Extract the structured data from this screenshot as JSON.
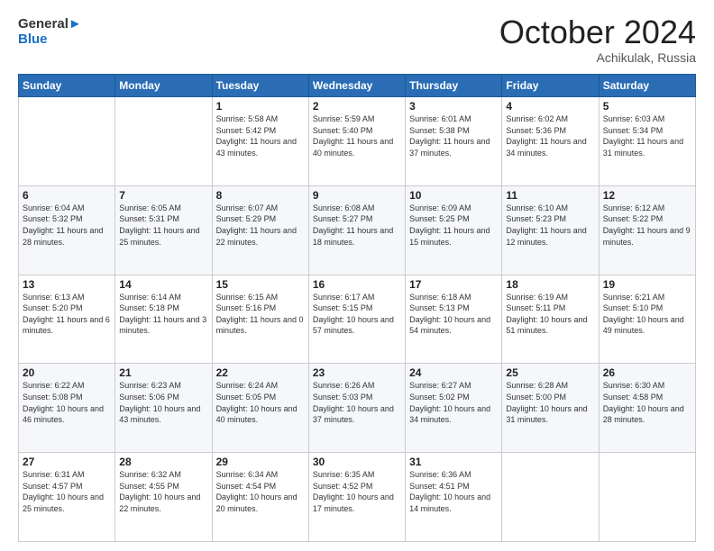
{
  "header": {
    "logo_general": "General",
    "logo_blue": "Blue",
    "month_title": "October 2024",
    "location": "Achikulak, Russia"
  },
  "weekdays": [
    "Sunday",
    "Monday",
    "Tuesday",
    "Wednesday",
    "Thursday",
    "Friday",
    "Saturday"
  ],
  "weeks": [
    [
      {
        "day": "",
        "info": ""
      },
      {
        "day": "",
        "info": ""
      },
      {
        "day": "1",
        "info": "Sunrise: 5:58 AM\nSunset: 5:42 PM\nDaylight: 11 hours and 43 minutes."
      },
      {
        "day": "2",
        "info": "Sunrise: 5:59 AM\nSunset: 5:40 PM\nDaylight: 11 hours and 40 minutes."
      },
      {
        "day": "3",
        "info": "Sunrise: 6:01 AM\nSunset: 5:38 PM\nDaylight: 11 hours and 37 minutes."
      },
      {
        "day": "4",
        "info": "Sunrise: 6:02 AM\nSunset: 5:36 PM\nDaylight: 11 hours and 34 minutes."
      },
      {
        "day": "5",
        "info": "Sunrise: 6:03 AM\nSunset: 5:34 PM\nDaylight: 11 hours and 31 minutes."
      }
    ],
    [
      {
        "day": "6",
        "info": "Sunrise: 6:04 AM\nSunset: 5:32 PM\nDaylight: 11 hours and 28 minutes."
      },
      {
        "day": "7",
        "info": "Sunrise: 6:05 AM\nSunset: 5:31 PM\nDaylight: 11 hours and 25 minutes."
      },
      {
        "day": "8",
        "info": "Sunrise: 6:07 AM\nSunset: 5:29 PM\nDaylight: 11 hours and 22 minutes."
      },
      {
        "day": "9",
        "info": "Sunrise: 6:08 AM\nSunset: 5:27 PM\nDaylight: 11 hours and 18 minutes."
      },
      {
        "day": "10",
        "info": "Sunrise: 6:09 AM\nSunset: 5:25 PM\nDaylight: 11 hours and 15 minutes."
      },
      {
        "day": "11",
        "info": "Sunrise: 6:10 AM\nSunset: 5:23 PM\nDaylight: 11 hours and 12 minutes."
      },
      {
        "day": "12",
        "info": "Sunrise: 6:12 AM\nSunset: 5:22 PM\nDaylight: 11 hours and 9 minutes."
      }
    ],
    [
      {
        "day": "13",
        "info": "Sunrise: 6:13 AM\nSunset: 5:20 PM\nDaylight: 11 hours and 6 minutes."
      },
      {
        "day": "14",
        "info": "Sunrise: 6:14 AM\nSunset: 5:18 PM\nDaylight: 11 hours and 3 minutes."
      },
      {
        "day": "15",
        "info": "Sunrise: 6:15 AM\nSunset: 5:16 PM\nDaylight: 11 hours and 0 minutes."
      },
      {
        "day": "16",
        "info": "Sunrise: 6:17 AM\nSunset: 5:15 PM\nDaylight: 10 hours and 57 minutes."
      },
      {
        "day": "17",
        "info": "Sunrise: 6:18 AM\nSunset: 5:13 PM\nDaylight: 10 hours and 54 minutes."
      },
      {
        "day": "18",
        "info": "Sunrise: 6:19 AM\nSunset: 5:11 PM\nDaylight: 10 hours and 51 minutes."
      },
      {
        "day": "19",
        "info": "Sunrise: 6:21 AM\nSunset: 5:10 PM\nDaylight: 10 hours and 49 minutes."
      }
    ],
    [
      {
        "day": "20",
        "info": "Sunrise: 6:22 AM\nSunset: 5:08 PM\nDaylight: 10 hours and 46 minutes."
      },
      {
        "day": "21",
        "info": "Sunrise: 6:23 AM\nSunset: 5:06 PM\nDaylight: 10 hours and 43 minutes."
      },
      {
        "day": "22",
        "info": "Sunrise: 6:24 AM\nSunset: 5:05 PM\nDaylight: 10 hours and 40 minutes."
      },
      {
        "day": "23",
        "info": "Sunrise: 6:26 AM\nSunset: 5:03 PM\nDaylight: 10 hours and 37 minutes."
      },
      {
        "day": "24",
        "info": "Sunrise: 6:27 AM\nSunset: 5:02 PM\nDaylight: 10 hours and 34 minutes."
      },
      {
        "day": "25",
        "info": "Sunrise: 6:28 AM\nSunset: 5:00 PM\nDaylight: 10 hours and 31 minutes."
      },
      {
        "day": "26",
        "info": "Sunrise: 6:30 AM\nSunset: 4:58 PM\nDaylight: 10 hours and 28 minutes."
      }
    ],
    [
      {
        "day": "27",
        "info": "Sunrise: 6:31 AM\nSunset: 4:57 PM\nDaylight: 10 hours and 25 minutes."
      },
      {
        "day": "28",
        "info": "Sunrise: 6:32 AM\nSunset: 4:55 PM\nDaylight: 10 hours and 22 minutes."
      },
      {
        "day": "29",
        "info": "Sunrise: 6:34 AM\nSunset: 4:54 PM\nDaylight: 10 hours and 20 minutes."
      },
      {
        "day": "30",
        "info": "Sunrise: 6:35 AM\nSunset: 4:52 PM\nDaylight: 10 hours and 17 minutes."
      },
      {
        "day": "31",
        "info": "Sunrise: 6:36 AM\nSunset: 4:51 PM\nDaylight: 10 hours and 14 minutes."
      },
      {
        "day": "",
        "info": ""
      },
      {
        "day": "",
        "info": ""
      }
    ]
  ]
}
